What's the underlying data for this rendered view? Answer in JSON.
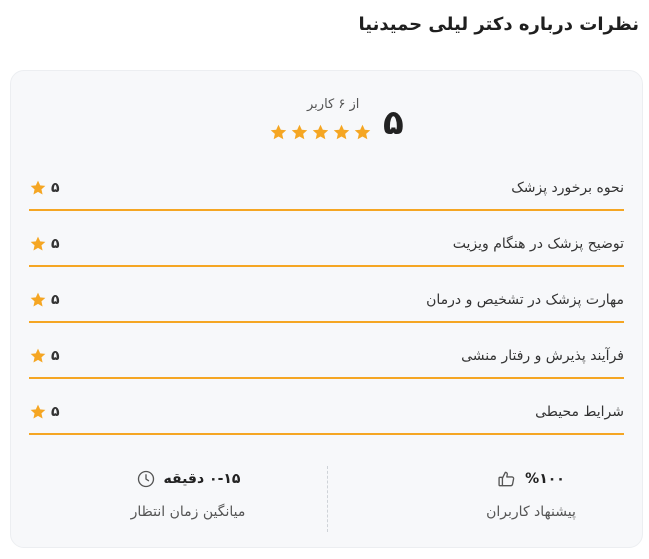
{
  "page": {
    "title": "نظرات درباره دکتر لیلی حمیدنیا"
  },
  "summary": {
    "score": "۵",
    "count_text": "از ۶ کاربر",
    "stars": 5,
    "star_color": "#f5a623"
  },
  "criteria": [
    {
      "label": "نحوه برخورد پزشک",
      "score": "۵"
    },
    {
      "label": "توضیح پزشک در هنگام ویزیت",
      "score": "۵"
    },
    {
      "label": "مهارت پزشک در تشخیص و درمان",
      "score": "۵"
    },
    {
      "label": "فرآیند پذیرش و رفتار منشی",
      "score": "۵"
    },
    {
      "label": "شرایط محیطی",
      "score": "۵"
    }
  ],
  "stats": {
    "recommend": {
      "value": "%۱۰۰",
      "label": "پیشنهاد کاربران",
      "icon": "thumbs-up-icon"
    },
    "wait_time": {
      "value": "۰-۱۵ دقیقه",
      "label": "میانگین زمان انتظار",
      "icon": "clock-icon"
    }
  },
  "colors": {
    "accent": "#f5a623",
    "card_bg": "#f7f8fa"
  }
}
